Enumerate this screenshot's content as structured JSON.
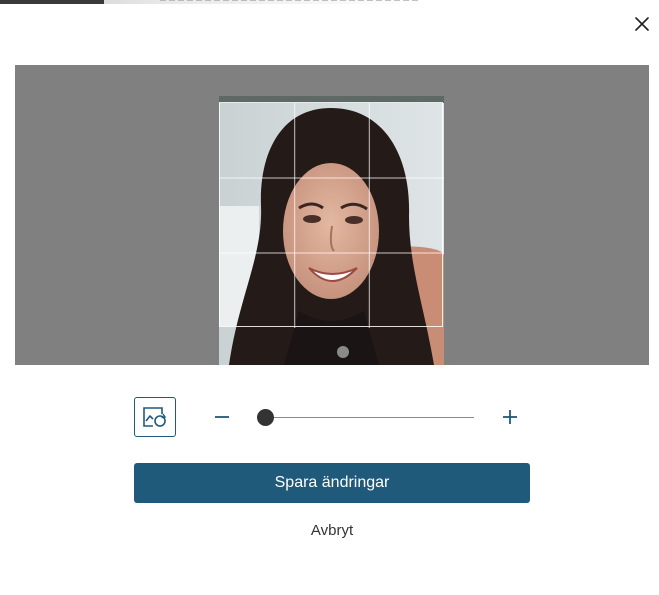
{
  "dialog": {
    "close_icon": "close-icon"
  },
  "editor": {
    "rotate_icon": "image-rotate-icon",
    "zoom": {
      "level": 0.0,
      "minus_icon": "minus-icon",
      "plus_icon": "plus-icon"
    }
  },
  "actions": {
    "save_label": "Spara ändringar",
    "cancel_label": "Avbryt"
  },
  "colors": {
    "primary": "#1f5a7a",
    "crop_background": "#808080",
    "slider_thumb": "#333333"
  }
}
